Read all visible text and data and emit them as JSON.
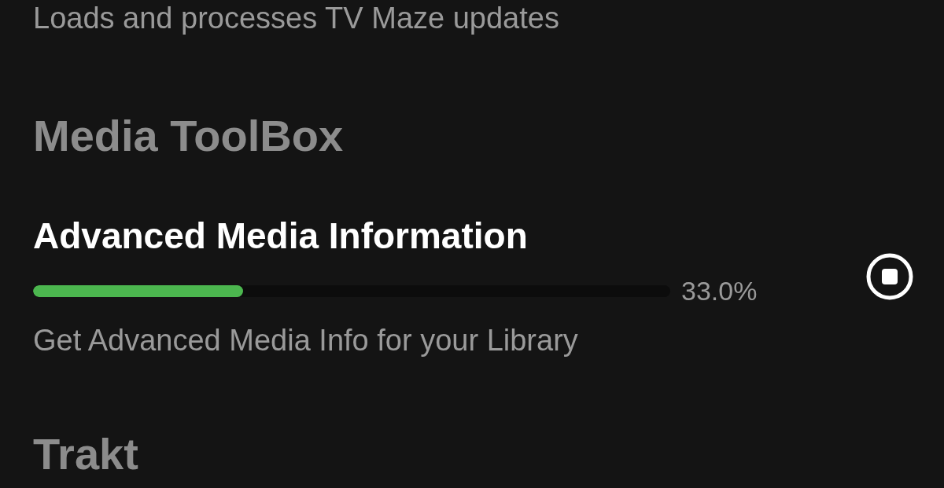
{
  "top_description": "Loads and processes TV Maze updates",
  "sections": [
    {
      "title": "Media ToolBox",
      "tasks": [
        {
          "name": "Advanced Media Information",
          "level": 0.33,
          "progress": "33.0%",
          "running": true,
          "description": "Get Advanced Media Info for your Library"
        }
      ]
    },
    {
      "title": "Trakt"
    }
  ]
}
